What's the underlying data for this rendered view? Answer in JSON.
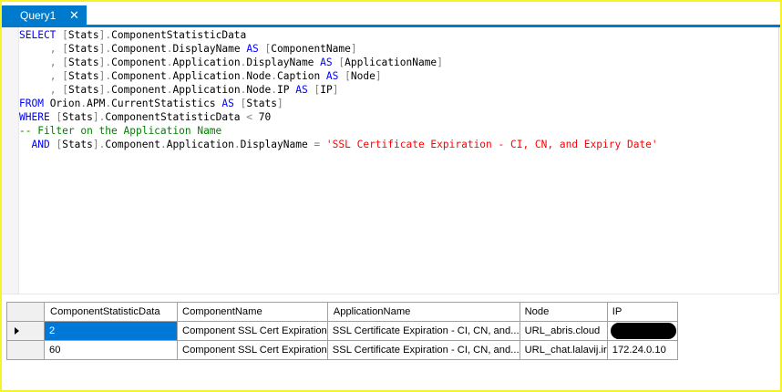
{
  "tab": {
    "title": "Query1",
    "close_glyph": "✕"
  },
  "editor": {
    "lines": [
      [
        [
          "kw",
          "SELECT"
        ],
        [
          "txt",
          " "
        ],
        [
          "op",
          "["
        ],
        [
          "txt",
          "Stats"
        ],
        [
          "op",
          "]."
        ],
        [
          "txt",
          "ComponentStatisticData"
        ]
      ],
      [
        [
          "txt",
          "     "
        ],
        [
          "op",
          ","
        ],
        [
          "txt",
          " "
        ],
        [
          "op",
          "["
        ],
        [
          "txt",
          "Stats"
        ],
        [
          "op",
          "]."
        ],
        [
          "txt",
          "Component"
        ],
        [
          "op",
          "."
        ],
        [
          "txt",
          "DisplayName "
        ],
        [
          "kw",
          "AS"
        ],
        [
          "txt",
          " "
        ],
        [
          "op",
          "["
        ],
        [
          "txt",
          "ComponentName"
        ],
        [
          "op",
          "]"
        ]
      ],
      [
        [
          "txt",
          "     "
        ],
        [
          "op",
          ","
        ],
        [
          "txt",
          " "
        ],
        [
          "op",
          "["
        ],
        [
          "txt",
          "Stats"
        ],
        [
          "op",
          "]."
        ],
        [
          "txt",
          "Component"
        ],
        [
          "op",
          "."
        ],
        [
          "txt",
          "Application"
        ],
        [
          "op",
          "."
        ],
        [
          "txt",
          "DisplayName "
        ],
        [
          "kw",
          "AS"
        ],
        [
          "txt",
          " "
        ],
        [
          "op",
          "["
        ],
        [
          "txt",
          "ApplicationName"
        ],
        [
          "op",
          "]"
        ]
      ],
      [
        [
          "txt",
          "     "
        ],
        [
          "op",
          ","
        ],
        [
          "txt",
          " "
        ],
        [
          "op",
          "["
        ],
        [
          "txt",
          "Stats"
        ],
        [
          "op",
          "]."
        ],
        [
          "txt",
          "Component"
        ],
        [
          "op",
          "."
        ],
        [
          "txt",
          "Application"
        ],
        [
          "op",
          "."
        ],
        [
          "txt",
          "Node"
        ],
        [
          "op",
          "."
        ],
        [
          "txt",
          "Caption "
        ],
        [
          "kw",
          "AS"
        ],
        [
          "txt",
          " "
        ],
        [
          "op",
          "["
        ],
        [
          "txt",
          "Node"
        ],
        [
          "op",
          "]"
        ]
      ],
      [
        [
          "txt",
          "     "
        ],
        [
          "op",
          ","
        ],
        [
          "txt",
          " "
        ],
        [
          "op",
          "["
        ],
        [
          "txt",
          "Stats"
        ],
        [
          "op",
          "]."
        ],
        [
          "txt",
          "Component"
        ],
        [
          "op",
          "."
        ],
        [
          "txt",
          "Application"
        ],
        [
          "op",
          "."
        ],
        [
          "txt",
          "Node"
        ],
        [
          "op",
          "."
        ],
        [
          "txt",
          "IP "
        ],
        [
          "kw",
          "AS"
        ],
        [
          "txt",
          " "
        ],
        [
          "op",
          "["
        ],
        [
          "txt",
          "IP"
        ],
        [
          "op",
          "]"
        ]
      ],
      [
        [
          "kw",
          "FROM"
        ],
        [
          "txt",
          " Orion"
        ],
        [
          "op",
          "."
        ],
        [
          "txt",
          "APM"
        ],
        [
          "op",
          "."
        ],
        [
          "txt",
          "CurrentStatistics "
        ],
        [
          "kw",
          "AS"
        ],
        [
          "txt",
          " "
        ],
        [
          "op",
          "["
        ],
        [
          "txt",
          "Stats"
        ],
        [
          "op",
          "]"
        ]
      ],
      [
        [
          "kw",
          "WHERE"
        ],
        [
          "txt",
          " "
        ],
        [
          "op",
          "["
        ],
        [
          "txt",
          "Stats"
        ],
        [
          "op",
          "]."
        ],
        [
          "txt",
          "ComponentStatisticData "
        ],
        [
          "op",
          "<"
        ],
        [
          "txt",
          " 70"
        ]
      ],
      [
        [
          "cm",
          "-- Filter on the Application Name"
        ]
      ],
      [
        [
          "txt",
          "  "
        ],
        [
          "kw",
          "AND"
        ],
        [
          "txt",
          " "
        ],
        [
          "op",
          "["
        ],
        [
          "txt",
          "Stats"
        ],
        [
          "op",
          "]."
        ],
        [
          "txt",
          "Component"
        ],
        [
          "op",
          "."
        ],
        [
          "txt",
          "Application"
        ],
        [
          "op",
          "."
        ],
        [
          "txt",
          "DisplayName "
        ],
        [
          "op",
          "="
        ],
        [
          "txt",
          " "
        ],
        [
          "str",
          "'SSL Certificate Expiration - CI, CN, and Expiry Date'"
        ]
      ]
    ]
  },
  "results": {
    "columns": [
      "ComponentStatisticData",
      "ComponentName",
      "ApplicationName",
      "Node",
      "IP"
    ],
    "rows": [
      {
        "selected": true,
        "redacted_ip": true,
        "cells": [
          "2",
          "Component SSL Cert Expiration",
          "SSL Certificate Expiration - CI, CN, and...",
          "URL_abris.cloud",
          ""
        ]
      },
      {
        "selected": false,
        "redacted_ip": false,
        "cells": [
          "60",
          "Component SSL Cert Expiration",
          "SSL Certificate Expiration - CI, CN, and...",
          "URL_chat.lalavij.ir",
          "172.24.0.10"
        ]
      }
    ]
  },
  "colors": {
    "accent": "#007acc",
    "selection": "#0078d7",
    "keyword": "#0000ff",
    "comment": "#008000",
    "string": "#ff0000",
    "frame": "#f7f22a"
  }
}
